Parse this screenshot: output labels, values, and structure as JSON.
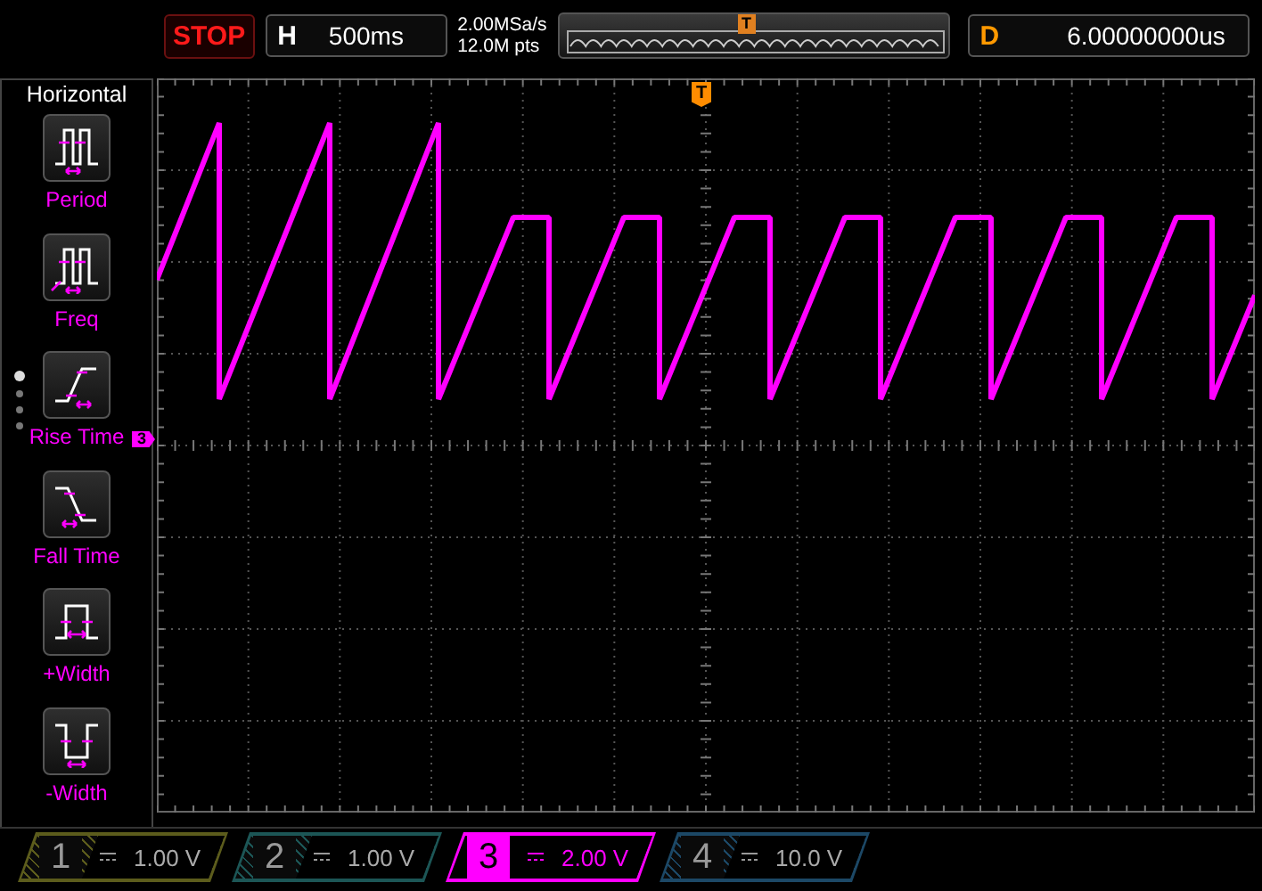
{
  "top_bar": {
    "run_state": "STOP",
    "horizontal": {
      "label": "H",
      "value": "500ms"
    },
    "sample_rate": "2.00MSa/s",
    "memory_depth": "12.0M pts",
    "overview_trigger": "T",
    "delay": {
      "label": "D",
      "value": "6.00000000us"
    }
  },
  "menu": {
    "title": "Horizontal",
    "items": [
      {
        "kind": "period",
        "label": "Period"
      },
      {
        "kind": "freq",
        "label": "Freq"
      },
      {
        "kind": "rise",
        "label": "Rise Time"
      },
      {
        "kind": "fall",
        "label": "Fall Time"
      },
      {
        "kind": "pwidth",
        "label": "+Width"
      },
      {
        "kind": "nwidth",
        "label": "-Width"
      }
    ],
    "page_dots": [
      {
        "selected": true
      },
      {
        "selected": false
      },
      {
        "selected": false
      },
      {
        "selected": false
      }
    ]
  },
  "display": {
    "channel_marker": "3",
    "trigger_marker": "T"
  },
  "channels": [
    {
      "number": "1",
      "scale": "1.00 V",
      "active": false,
      "color": "#5c5c1c"
    },
    {
      "number": "2",
      "scale": "1.00 V",
      "active": false,
      "color": "#1c5656"
    },
    {
      "number": "3",
      "scale": "2.00 V",
      "active": true,
      "color": "#ff00ff"
    },
    {
      "number": "4",
      "scale": "10.0 V",
      "active": false,
      "color": "#1c4866"
    }
  ]
}
